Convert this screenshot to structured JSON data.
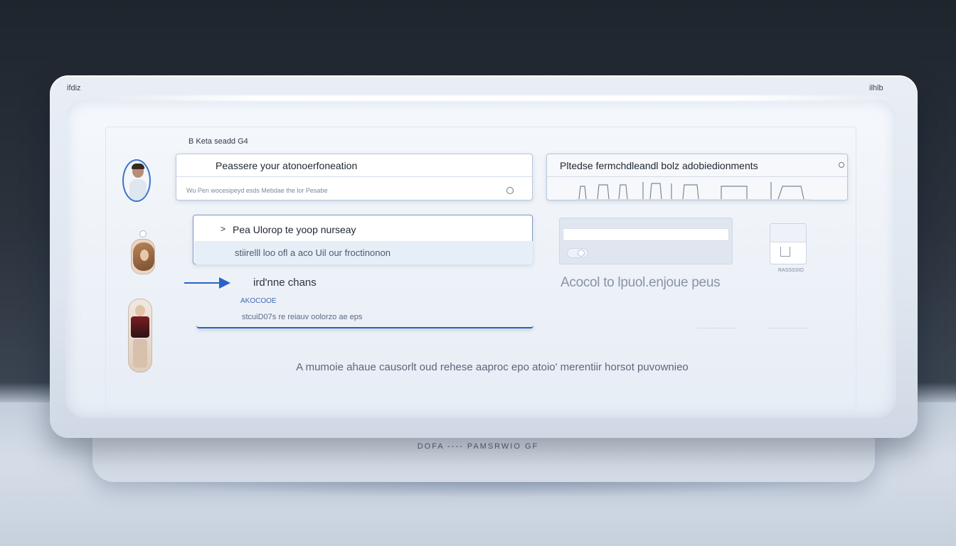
{
  "device": {
    "corner_left": "ifdiz",
    "corner_right": "ilhlb",
    "base_label": "DOFA ---- PAMSRWIO  GF"
  },
  "screen": {
    "breadcrumb": "B Keta seadd G4",
    "card_a": {
      "title": "Peassere your atonoerfoneation",
      "subtitle": "Wu Pen wocesipeyd esds  Mebdae the lor Pesabe"
    },
    "card_b": {
      "title": "Pltedse fermchdleandl bolz adobiedionments"
    },
    "card_c": {
      "chevron": ">",
      "title": "Pea Ulorop te yoop nurseay",
      "subtitle": "stiirelll loo ofl a aco Uil our froctinonon"
    },
    "section": {
      "label": "ird'nne chans",
      "code": "AKOCOOE",
      "desc": "stcuiD07s re reiauv oolorzo ae eps"
    },
    "right_heading": "Acocol to lpuol.enjoue peus",
    "doc_caption": "RASSSSIO",
    "footer": "A mumoie ahaue causorlt oud rehese aaproc epo atoio' merentiir horsot puvownieo"
  },
  "colors": {
    "accent": "#2a62c6",
    "card_border": "#b9c7da",
    "screen_bg": "#f5f8fc"
  },
  "icons": [
    "user-avatar",
    "radio-icon",
    "arrow-right-icon",
    "chevron-right-icon",
    "document-icon",
    "bar-graph-icon"
  ]
}
